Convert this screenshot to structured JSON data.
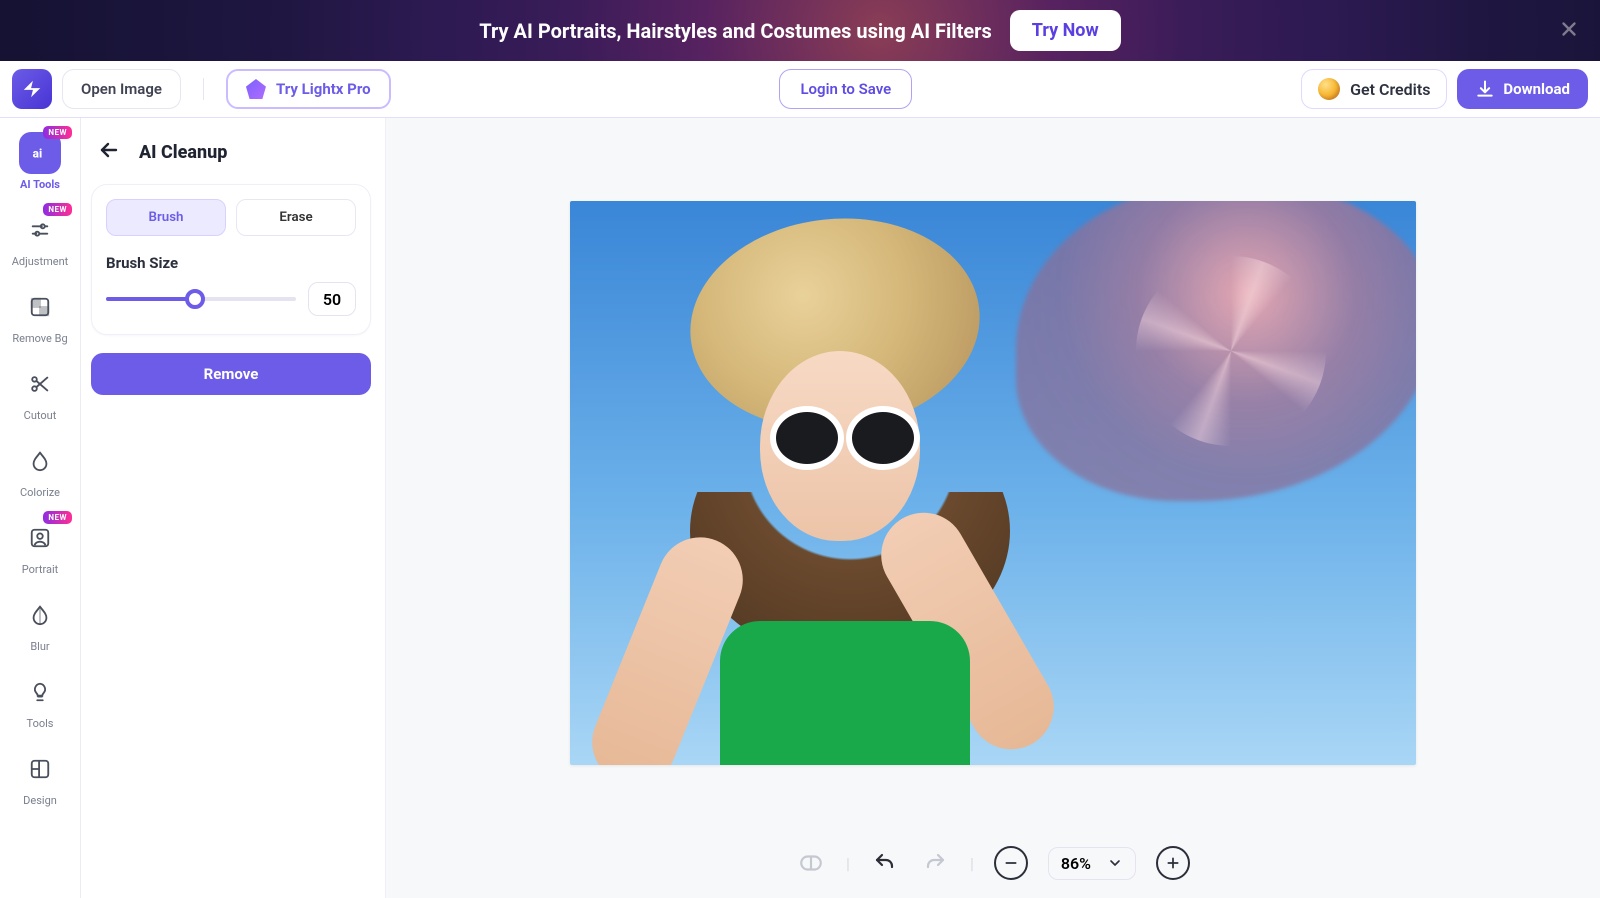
{
  "promo": {
    "text": "Try AI Portraits, Hairstyles and Costumes using AI Filters",
    "cta": "Try Now"
  },
  "topbar": {
    "open_image": "Open Image",
    "try_pro": "Try Lightx Pro",
    "login_save": "Login to Save",
    "get_credits": "Get Credits",
    "download": "Download"
  },
  "rail": {
    "items": [
      {
        "label": "AI Tools",
        "badge": "NEW",
        "active": true
      },
      {
        "label": "Adjustment",
        "badge": "NEW"
      },
      {
        "label": "Remove Bg"
      },
      {
        "label": "Cutout"
      },
      {
        "label": "Colorize"
      },
      {
        "label": "Portrait",
        "badge": "NEW"
      },
      {
        "label": "Blur"
      },
      {
        "label": "Tools"
      },
      {
        "label": "Design"
      }
    ]
  },
  "panel": {
    "title": "AI Cleanup",
    "brush_tab": "Brush",
    "erase_tab": "Erase",
    "brush_size_label": "Brush Size",
    "brush_size_value": "50",
    "slider_percent": 47,
    "remove": "Remove"
  },
  "zoom": {
    "value": "86%"
  }
}
